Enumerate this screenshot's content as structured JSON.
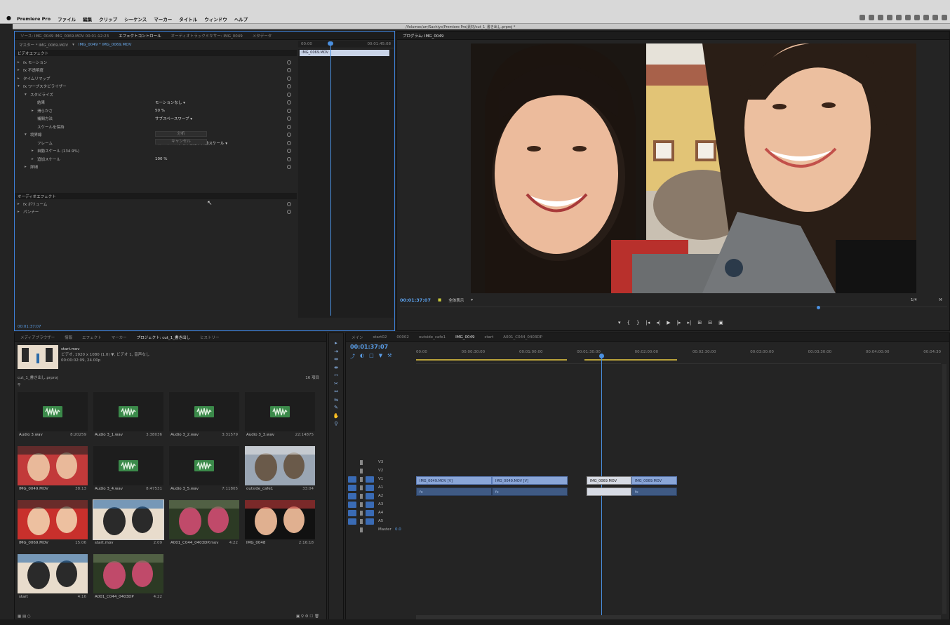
{
  "menubar": {
    "apple": "",
    "items": [
      "Premiere Pro",
      "ファイル",
      "編集",
      "クリップ",
      "シーケンス",
      "マーカー",
      "タイトル",
      "ウィンドウ",
      "ヘルプ"
    ],
    "document": "/Volumes/arr/Sachiyo/Premiere Pro/素材/cut_1_書き出し.prproj *"
  },
  "effect": {
    "tabs": [
      "ソース: IMG_0049 IMG_0069.MOV 00:01:12:23",
      "エフェクトコントロール",
      "オーディオトラックミキサー: IMG_0049",
      "メタデータ"
    ],
    "master": "マスター * IMG_0069.MOV",
    "sequence_link": "IMG_0049 * IMG_0069.MOV",
    "video_effects": "ビデオエフェクト",
    "audio_effects": "オーディオエフェクト",
    "rows": [
      {
        "tri": "▸",
        "indent": 0,
        "label": "fx モーション",
        "val": ""
      },
      {
        "tri": "▸",
        "indent": 0,
        "label": "fx 不透明度",
        "val": ""
      },
      {
        "tri": "▸",
        "indent": 0,
        "label": "タイムリマップ",
        "val": ""
      },
      {
        "tri": "▾",
        "indent": 0,
        "label": "fx ワープスタビライザー",
        "val": ""
      },
      {
        "tri": "▾",
        "indent": 1,
        "label": "スタビライズ",
        "val": ""
      },
      {
        "tri": "",
        "indent": 2,
        "label": "結果",
        "val": "モーションなし ▾"
      },
      {
        "tri": "▸",
        "indent": 2,
        "label": "滑らかさ",
        "val": "50 %"
      },
      {
        "tri": "",
        "indent": 2,
        "label": "補間方法",
        "val": "サブスペースワープ ▾"
      },
      {
        "tri": "",
        "indent": 2,
        "label": "スケールを保持",
        "val": ""
      },
      {
        "tri": "▾",
        "indent": 1,
        "label": "境界線",
        "val": ""
      },
      {
        "tri": "",
        "indent": 2,
        "label": "フレーム",
        "val": "スタビライズ、切り抜き、自動スケール ▾"
      },
      {
        "tri": "▸",
        "indent": 2,
        "label": "自動スケール (134.9%)",
        "val": ""
      },
      {
        "tri": "▸",
        "indent": 2,
        "label": "追加スケール",
        "val": "100 %"
      },
      {
        "tri": "▸",
        "indent": 1,
        "label": "詳細",
        "val": ""
      }
    ],
    "btn_analyze": "分析",
    "btn_cancel": "キャンセル",
    "audio_rows": [
      {
        "tri": "▸",
        "label": "fx ボリューム"
      },
      {
        "tri": "▸",
        "label": "パンナー"
      }
    ],
    "tl_start": "00:00",
    "tl_end": "00:01:45:08",
    "tl_clip": "IMG_0069.MOV",
    "timecode": "00:01:37:07"
  },
  "program": {
    "tab": "プログラム: IMG_0049",
    "timecode": "00:01:37:07",
    "fit": "全体表示",
    "quality": "1/4",
    "transport": [
      "▾",
      "{",
      "}",
      "|◂",
      "◂|",
      "▶",
      "|▸",
      "▸|",
      "⊞",
      "⊟",
      "▣"
    ]
  },
  "project": {
    "tabs": [
      "メディアブラウザー",
      "情報",
      "エフェクト",
      "マーカー",
      "プロジェクト: cut_1_書き出し",
      "ヒストリー"
    ],
    "selected_name": "start.mov",
    "selected_meta": "ビデオ, 1920 x 1080 (1.0) ▼, ビデオ 1, 音声なし",
    "selected_dur": "00:00:02:09, 24.00p",
    "project_file": "cut_1_書き出し.prproj",
    "count": "16 項目",
    "items": [
      {
        "name": "Audio 3.wav",
        "dur": "8:20259",
        "kind": "audio"
      },
      {
        "name": "Audio 3_1.wav",
        "dur": "3:38036",
        "kind": "audio"
      },
      {
        "name": "Audio 3_2.wav",
        "dur": "3:31579",
        "kind": "audio"
      },
      {
        "name": "Audio 3_3.wav",
        "dur": "22:14875",
        "kind": "audio"
      },
      {
        "name": "IMG_0049.MOV",
        "dur": "38:13",
        "kind": "video"
      },
      {
        "name": "Audio 3_4.wav",
        "dur": "8:47531",
        "kind": "audio"
      },
      {
        "name": "Audio 3_5.wav",
        "dur": "7:11805",
        "kind": "audio"
      },
      {
        "name": "outside_cafe1",
        "dur": "33:04",
        "kind": "video"
      },
      {
        "name": "IMG_0069.MOV",
        "dur": "15:06",
        "kind": "video"
      },
      {
        "name": "start.mov",
        "dur": "2:09",
        "kind": "video"
      },
      {
        "name": "A001_C044_0403DP.mov",
        "dur": "4:22",
        "kind": "video"
      },
      {
        "name": "IMG_0048",
        "dur": "2:16:18",
        "kind": "video"
      },
      {
        "name": "start",
        "dur": "4:16",
        "kind": "video"
      },
      {
        "name": "A001_C044_0403DP",
        "dur": "4:22",
        "kind": "video"
      }
    ]
  },
  "timeline": {
    "tabs": [
      "メイン",
      "start02",
      "00002",
      "outside_cafe1",
      "IMG_0049",
      "start",
      "A001_C044_0403DP"
    ],
    "timecode": "00:01:37:07",
    "ruler": [
      "00:00",
      "00:00:30:00",
      "00:01:00:00",
      "00:01:30:00",
      "00:02:00:00",
      "00:02:30:00",
      "00:03:00:00",
      "00:03:30:00",
      "00:04:00:00",
      "00:04:30"
    ],
    "tracks": [
      "V3",
      "V2",
      "V1",
      "A1",
      "A2",
      "A3",
      "A4",
      "A5",
      "Master"
    ],
    "master_val": "0.0",
    "clips": {
      "v1a": "IMG_0049.MOV [V]",
      "v1b": "IMG_0049.MOV [V]",
      "v1c": "IMG_0069.MOV",
      "v1d": "IMG_0069.MOV",
      "a1a": "fx",
      "a1b": "fx",
      "a1d": "fx"
    }
  }
}
